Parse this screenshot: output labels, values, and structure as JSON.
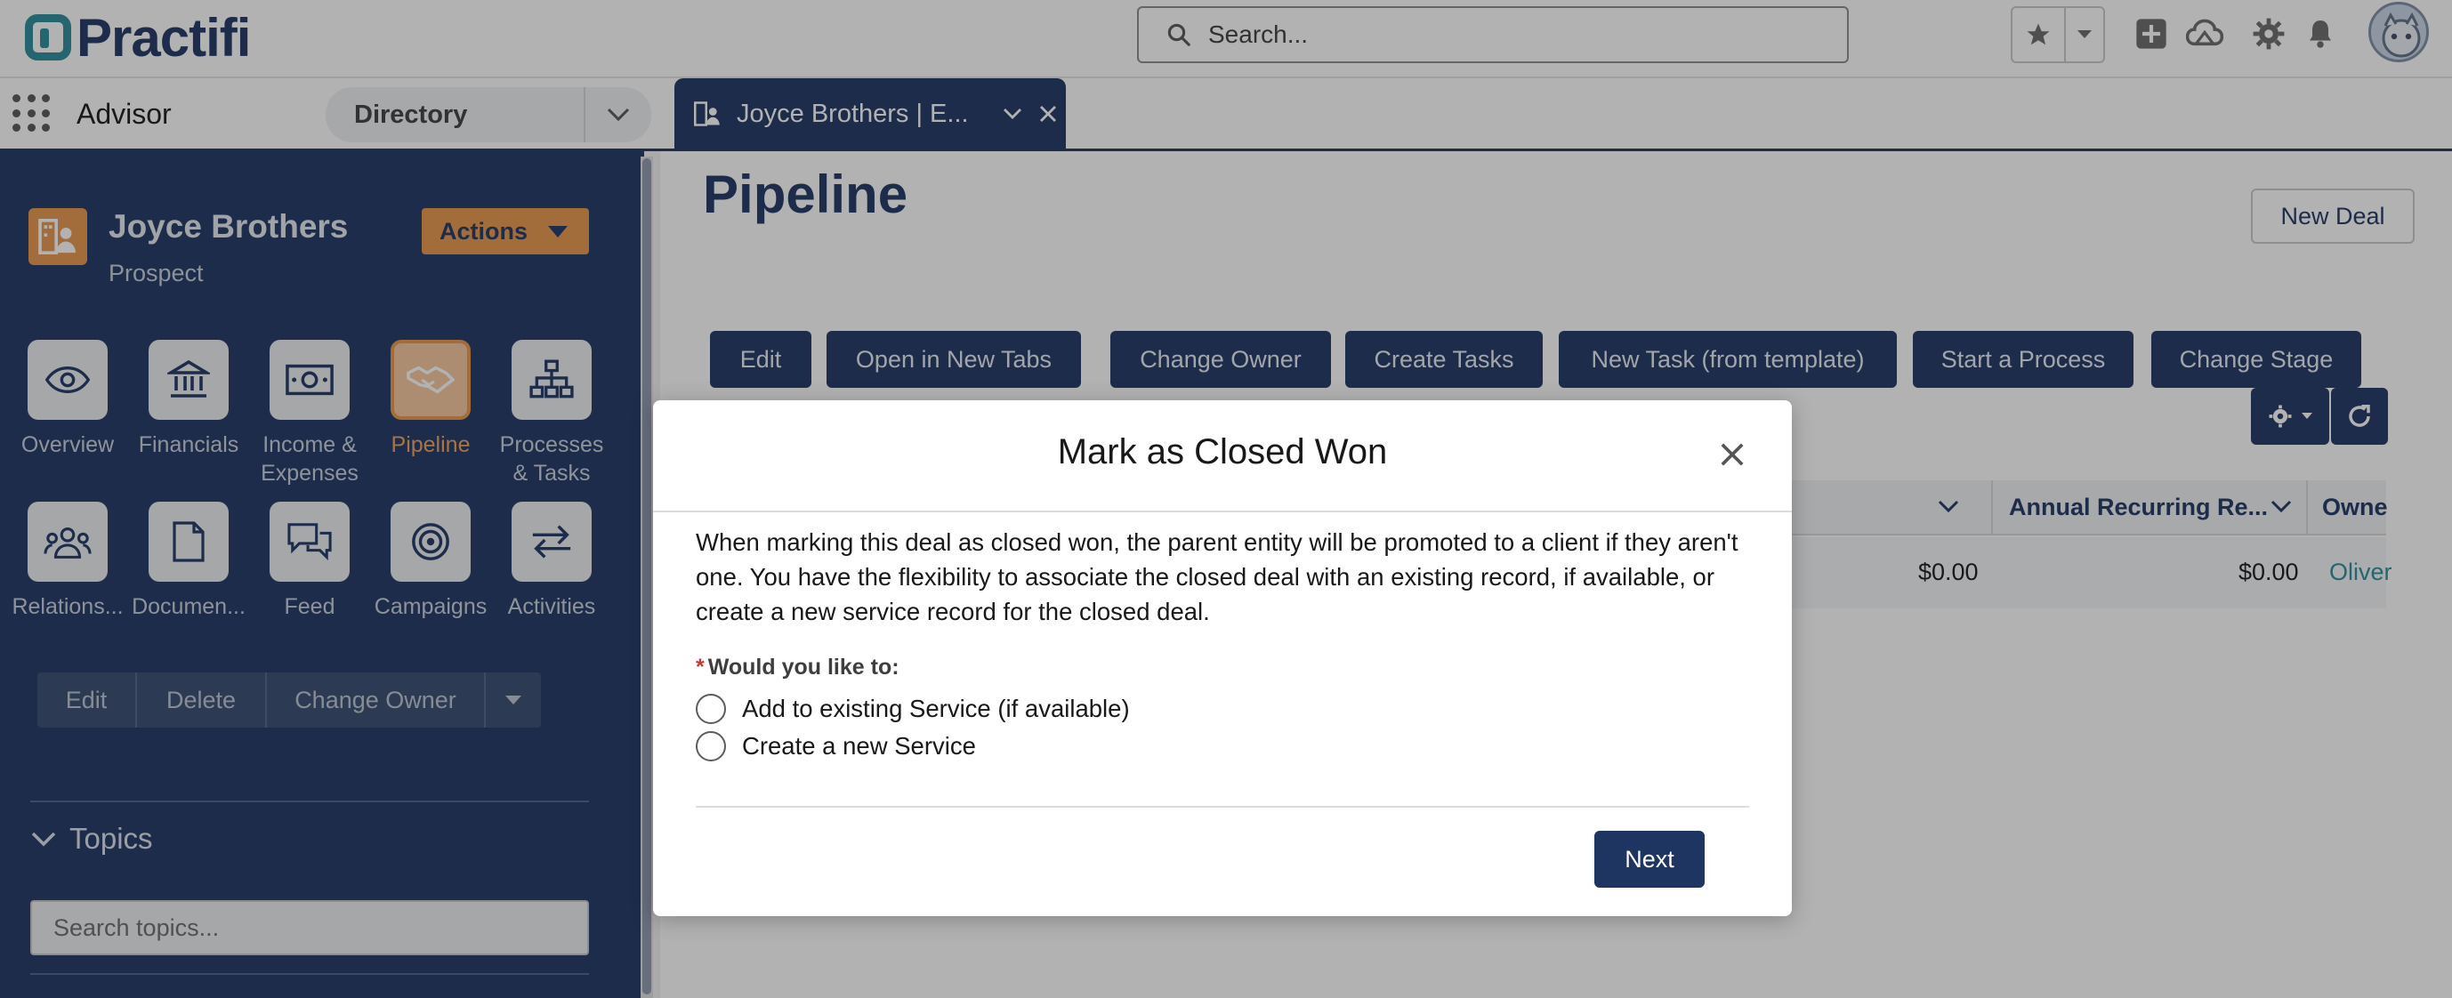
{
  "brand": {
    "name": "Practifi"
  },
  "global_search": {
    "placeholder": "Search..."
  },
  "nav": {
    "app_name": "Advisor",
    "directory_label": "Directory",
    "tab_label": "Joyce Brothers | E..."
  },
  "entity": {
    "name": "Joyce Brothers",
    "type": "Prospect",
    "actions_label": "Actions"
  },
  "entity_nav": [
    {
      "label": "Overview",
      "icon": "eye-icon",
      "active": false
    },
    {
      "label": "Financials",
      "icon": "bank-icon",
      "active": false
    },
    {
      "label": "Income & Expenses",
      "icon": "money-icon",
      "active": false
    },
    {
      "label": "Pipeline",
      "icon": "handshake-icon",
      "active": true
    },
    {
      "label": "Processes & Tasks",
      "icon": "hierarchy-icon",
      "active": false
    },
    {
      "label": "Relations...",
      "icon": "people-icon",
      "active": false
    },
    {
      "label": "Documen...",
      "icon": "document-icon",
      "active": false
    },
    {
      "label": "Feed",
      "icon": "chat-icon",
      "active": false
    },
    {
      "label": "Campaigns",
      "icon": "target-icon",
      "active": false
    },
    {
      "label": "Activities",
      "icon": "swap-icon",
      "active": false
    }
  ],
  "record_actions": {
    "edit": "Edit",
    "delete": "Delete",
    "change_owner": "Change Owner"
  },
  "topics": {
    "title": "Topics",
    "search_placeholder": "Search topics..."
  },
  "page": {
    "title": "Pipeline",
    "new_deal": "New Deal",
    "toolbar": [
      "Edit",
      "Open in New Tabs",
      "Change Owner",
      "Create Tasks",
      "New Task (from template)",
      "Start a Process",
      "Change Stage"
    ]
  },
  "table": {
    "columns": [
      "Annual Recurring Re...",
      "Owne"
    ],
    "row": {
      "amount_1": "$0.00",
      "amount_2": "$0.00",
      "owner": "Oliver"
    }
  },
  "modal": {
    "title": "Mark as Closed Won",
    "body": "When marking this deal as closed won, the parent entity will be promoted to a client if they aren't one. You have the flexibility to associate the closed deal with an existing record, if available, or create a new service record for the closed deal.",
    "question_required": "*",
    "question": "Would you like to:",
    "options": [
      "Add to existing Service (if available)",
      "Create a new Service"
    ],
    "next_label": "Next"
  },
  "colors": {
    "navy": "#1e3561",
    "accent_orange": "#e9964b",
    "teal": "#2a8a99"
  }
}
